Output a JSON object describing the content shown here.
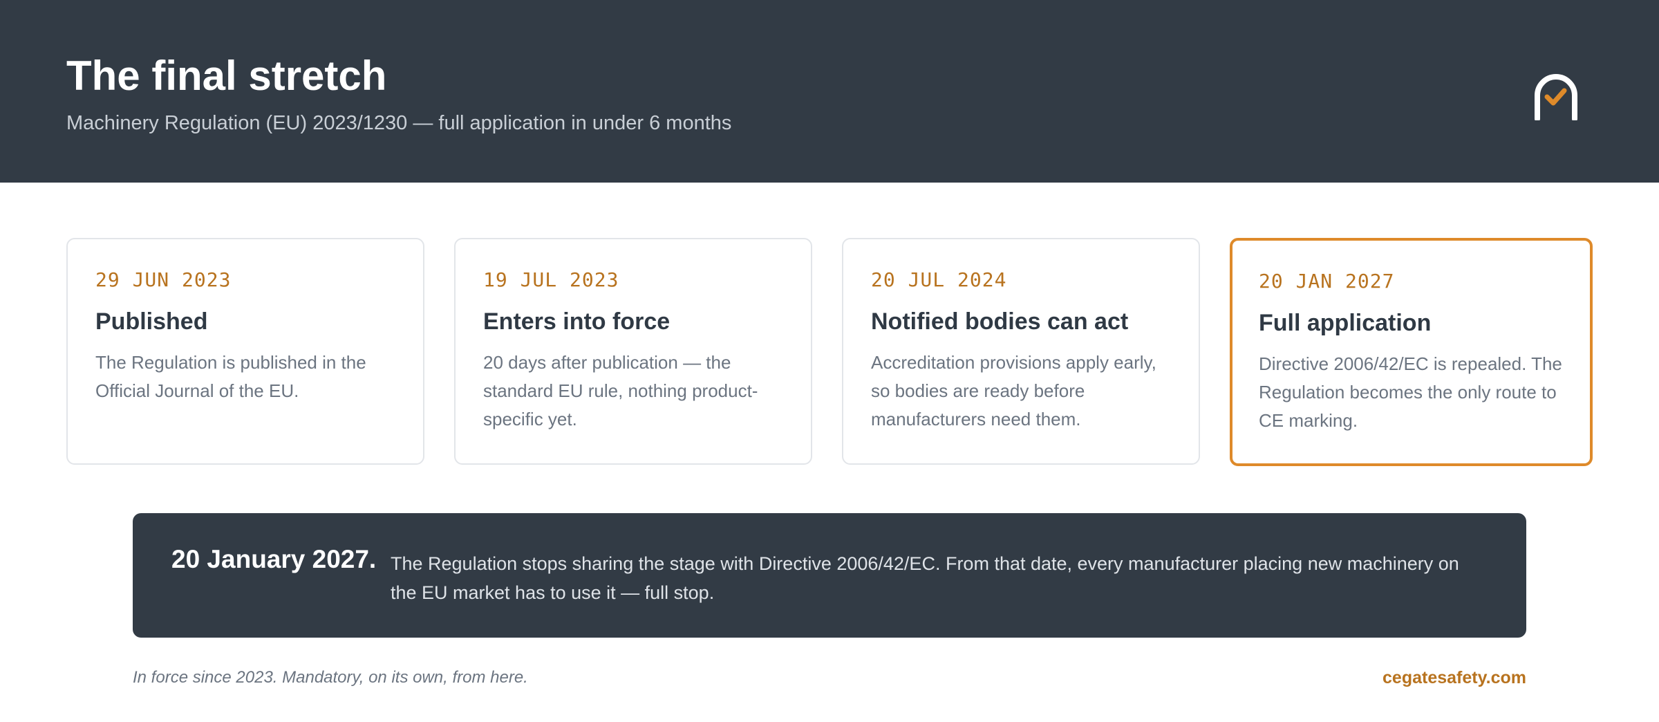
{
  "header": {
    "title": "The final stretch",
    "subtitle": "Machinery Regulation (EU) 2023/1230 — full application in under 6 months"
  },
  "logo": {
    "icon": "arch-check-icon",
    "arch_color": "#ffffff",
    "check_color": "#de8a2a"
  },
  "cards": [
    {
      "date": "29 JUN 2023",
      "title": "Published",
      "body": "The Regulation is published in the Official Journal of the EU."
    },
    {
      "date": "19 JUL 2023",
      "title": "Enters into force",
      "body": "20 days after publication — the standard EU rule, nothing product-specific yet."
    },
    {
      "date": "20 JUL 2024",
      "title": "Notified bodies can act",
      "body": "Accreditation provisions apply early, so bodies are ready before manufacturers need them."
    },
    {
      "date": "20 JAN 2027",
      "title": "Full application",
      "body": "Directive 2006/42/EC is repealed. The Regulation becomes the only route to CE marking.",
      "highlighted": true
    }
  ],
  "banner": {
    "date": "20 January 2027.",
    "text": "The Regulation stops sharing the stage with Directive 2006/42/EC. From that date, every manufacturer placing new machinery on the EU market has to use it — full stop."
  },
  "footer": {
    "note": "In force since 2023. Mandatory, on its own, from here.",
    "link": "cegatesafety.com"
  },
  "colors": {
    "dark": "#323b45",
    "accent": "#de8a2a",
    "accent_text": "#b8731f"
  }
}
